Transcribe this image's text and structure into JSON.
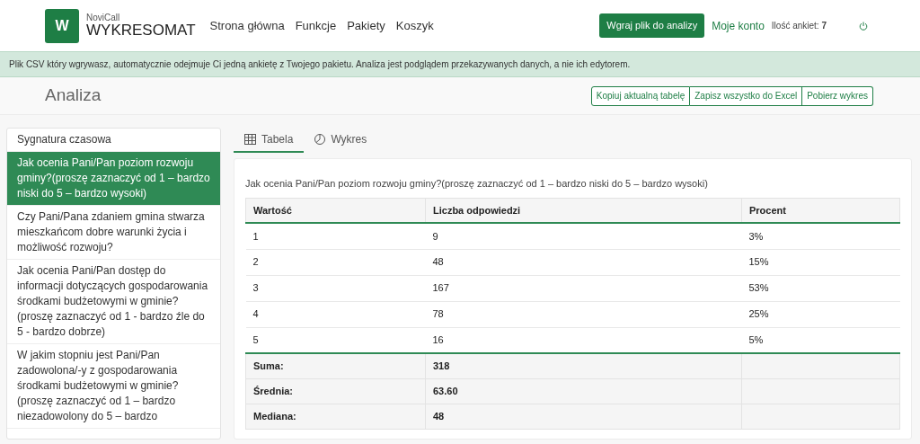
{
  "header": {
    "logo_small": "NoviCall",
    "logo_big": "WYKRESOMAT",
    "logo_letter": "W",
    "nav": [
      "Strona główna",
      "Funkcje",
      "Pakiety",
      "Koszyk"
    ],
    "upload_button": "Wgraj plik do analizy",
    "account_link": "Moje konto",
    "surveys_label": "Ilość ankiet:",
    "surveys_count": "7"
  },
  "notice": "Plik CSV który wgrywasz, automatycznie odejmuje Ci jedną ankietę z Twojego pakietu. Analiza jest podglądem przekazywanych danych, a nie ich edytorem.",
  "page_title": "Analiza",
  "actions": [
    "Kopiuj aktualną tabelę",
    "Zapisz wszystko do Excel",
    "Pobierz wykres"
  ],
  "sidebar": {
    "items": [
      {
        "label": "Sygnatura czasowa",
        "selected": false
      },
      {
        "label": "Jak ocenia Pani/Pan poziom rozwoju gminy?(proszę zaznaczyć od 1 – bardzo niski do 5 – bardzo wysoki)",
        "selected": true
      },
      {
        "label": "Czy Pani/Pana zdaniem gmina stwarza mieszkańcom dobre warunki życia i możliwość rozwoju?",
        "selected": false
      },
      {
        "label": "Jak ocenia Pani/Pan dostęp do informacji dotyczących gospodarowania środkami budżetowymi w gminie?(proszę zaznaczyć od 1 - bardzo źle do 5 - bardzo dobrze)",
        "selected": false
      },
      {
        "label": "W jakim stopniu jest Pani/Pan zadowolona/-y z gospodarowania środkami budżetowymi w gminie?(proszę zaznaczyć od 1 – bardzo niezadowolony do 5 – bardzo",
        "selected": false
      }
    ]
  },
  "tabs": [
    {
      "label": "Tabela",
      "kind": "table",
      "selected": true
    },
    {
      "label": "Wykres",
      "kind": "chart",
      "selected": false
    }
  ],
  "table": {
    "caption": "Jak ocenia Pani/Pan poziom rozwoju gminy?(proszę zaznaczyć od 1 – bardzo niski do 5 – bardzo wysoki)",
    "columns": [
      "Wartość",
      "Liczba odpowiedzi",
      "Procent"
    ],
    "rows": [
      [
        "1",
        "9",
        "3%"
      ],
      [
        "2",
        "48",
        "15%"
      ],
      [
        "3",
        "167",
        "53%"
      ],
      [
        "4",
        "78",
        "25%"
      ],
      [
        "5",
        "16",
        "5%"
      ]
    ],
    "summary": [
      [
        "Suma:",
        "318"
      ],
      [
        "Średnia:",
        "63.60"
      ],
      [
        "Mediana:",
        "48"
      ]
    ]
  }
}
